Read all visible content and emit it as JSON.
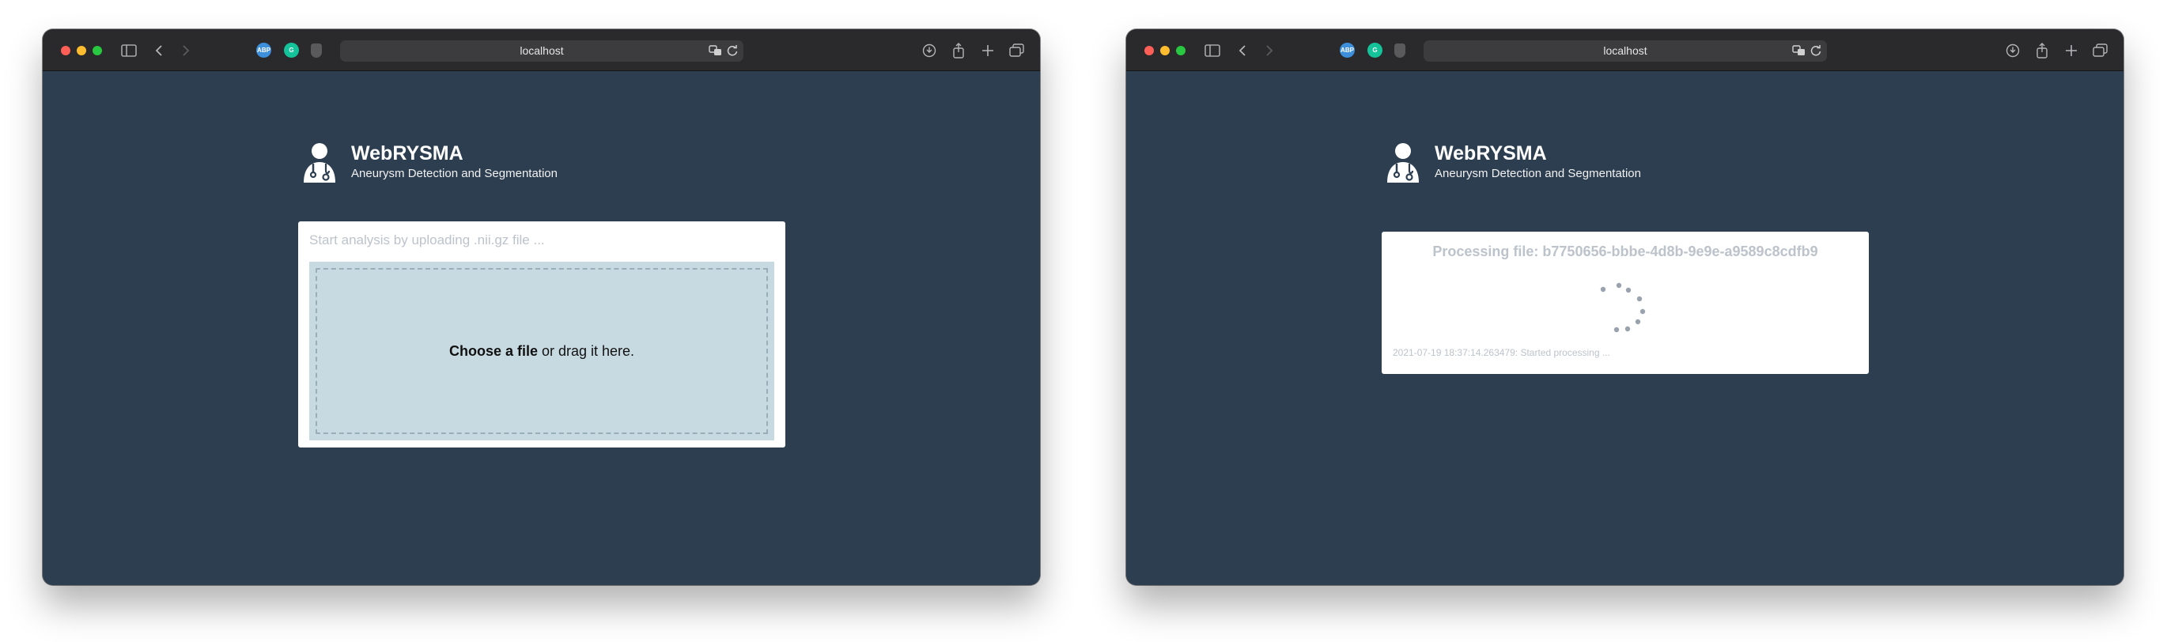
{
  "windows": [
    {
      "url": "localhost",
      "extensions": [
        "ABP",
        "G"
      ],
      "brand": {
        "title": "WebRYSMA",
        "subtitle": "Aneurysm Detection and Segmentation",
        "icon": "doctor-icon"
      },
      "upload": {
        "title": "Start analysis by uploading .nii.gz file ...",
        "choose_label": "Choose a file",
        "drag_label": "or drag it here."
      }
    },
    {
      "url": "localhost",
      "extensions": [
        "ABP",
        "G"
      ],
      "brand": {
        "title": "WebRYSMA",
        "subtitle": "Aneurysm Detection and Segmentation",
        "icon": "doctor-icon"
      },
      "processing": {
        "title": "Processing file: b7750656-bbbe-4d8b-9e9e-a9589c8cdfb9",
        "log": "2021-07-19 18:37:14.263479: Started processing ..."
      }
    }
  ],
  "colors": {
    "page_bg": "#2d3e50",
    "toolbar_bg": "#2a2a2c",
    "dropzone_bg": "#c8dae1",
    "muted_text": "#bcc3cb",
    "abp_blue": "#3d8fdc",
    "grammarly_green": "#15c39a"
  }
}
